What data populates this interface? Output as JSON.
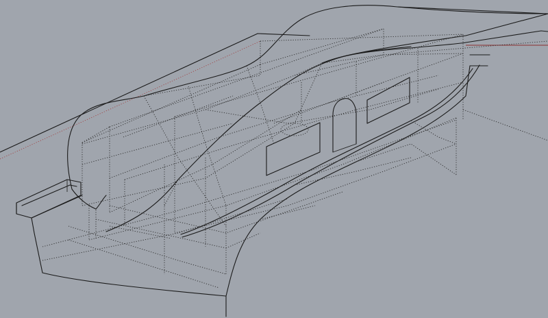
{
  "viewport": {
    "background": "#a0a5ad",
    "line_color": "#1a1a1a",
    "hidden_line_color": "#2a2a2a",
    "accent_line_color": "#a23a3a"
  }
}
